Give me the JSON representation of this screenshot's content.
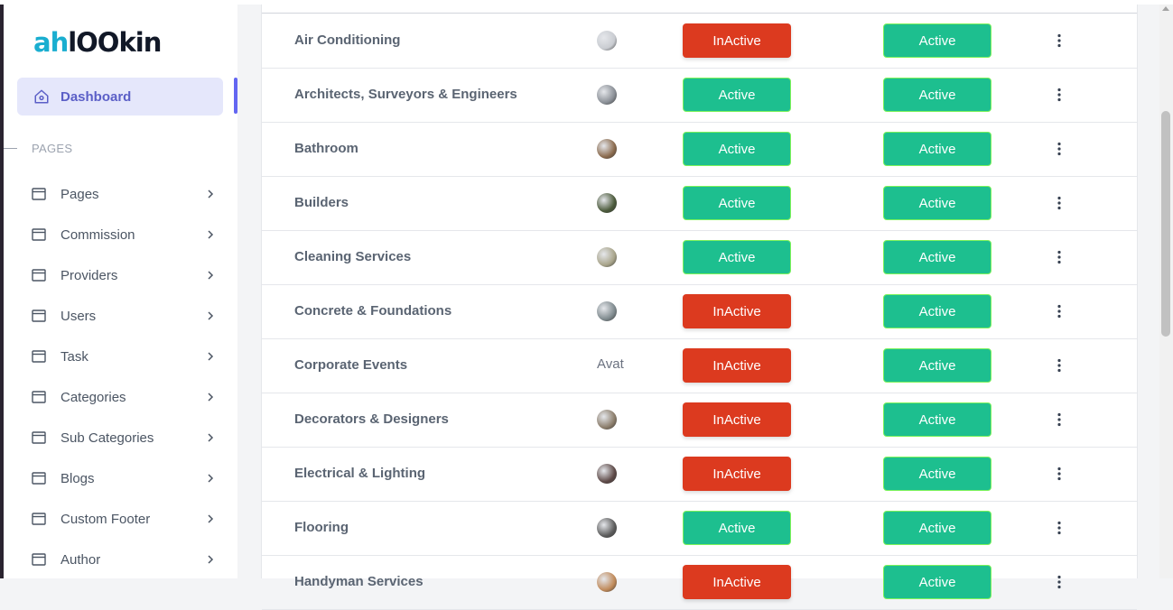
{
  "app": {
    "logo_text_a": "ah",
    "logo_text_b": "lOOkin",
    "brand_color": "#1aaed0"
  },
  "sidebar": {
    "dashboard_label": "Dashboard",
    "section_label": "PAGES",
    "items": [
      {
        "label": "Pages"
      },
      {
        "label": "Commission"
      },
      {
        "label": "Providers"
      },
      {
        "label": "Users"
      },
      {
        "label": "Task"
      },
      {
        "label": "Categories"
      },
      {
        "label": "Sub Categories"
      },
      {
        "label": "Blogs"
      },
      {
        "label": "Custom Footer"
      },
      {
        "label": "Author"
      }
    ]
  },
  "table": {
    "rows": [
      {
        "name": "Air Conditioning",
        "avatar": "image",
        "status1": "InActive",
        "status2": "Active"
      },
      {
        "name": "Architects, Surveyors & Engineers",
        "avatar": "image",
        "status1": "Active",
        "status2": "Active"
      },
      {
        "name": "Bathroom",
        "avatar": "image",
        "status1": "Active",
        "status2": "Active"
      },
      {
        "name": "Builders",
        "avatar": "image",
        "status1": "Active",
        "status2": "Active"
      },
      {
        "name": "Cleaning Services",
        "avatar": "image",
        "status1": "Active",
        "status2": "Active"
      },
      {
        "name": "Concrete & Foundations",
        "avatar": "image",
        "status1": "InActive",
        "status2": "Active"
      },
      {
        "name": "Corporate Events",
        "avatar": "broken",
        "avatar_alt": "Avat",
        "status1": "InActive",
        "status2": "Active"
      },
      {
        "name": "Decorators & Designers",
        "avatar": "image",
        "status1": "InActive",
        "status2": "Active"
      },
      {
        "name": "Electrical & Lighting",
        "avatar": "image",
        "status1": "InActive",
        "status2": "Active"
      },
      {
        "name": "Flooring",
        "avatar": "image",
        "status1": "Active",
        "status2": "Active"
      },
      {
        "name": "Handyman Services",
        "avatar": "image",
        "status1": "InActive",
        "status2": "Active"
      }
    ]
  },
  "colors": {
    "inactive": "#dc3a1f",
    "active": "#1dbf8f",
    "accent": "#6366f1"
  }
}
